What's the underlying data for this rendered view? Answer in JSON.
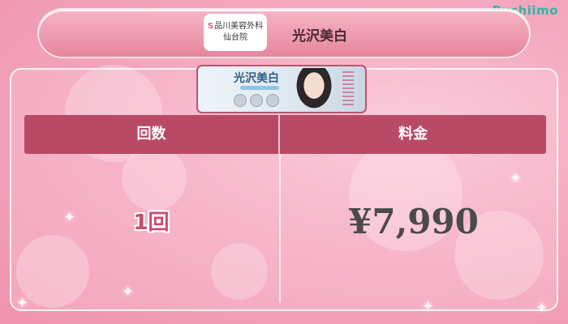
{
  "brand": "Puchiimo",
  "header": {
    "clinic_name_line1": "品川美容外科",
    "clinic_name_line2": "仙台院",
    "title": "光沢美白"
  },
  "promo": {
    "title": "光沢美白"
  },
  "table": {
    "headers": {
      "count": "回数",
      "price": "料金"
    },
    "rows": [
      {
        "count": "1回",
        "price": "¥7,990"
      }
    ]
  },
  "colors": {
    "header_band": "#b94a66",
    "accent_text": "#c94b6f",
    "brand": "#2fb7a3"
  }
}
